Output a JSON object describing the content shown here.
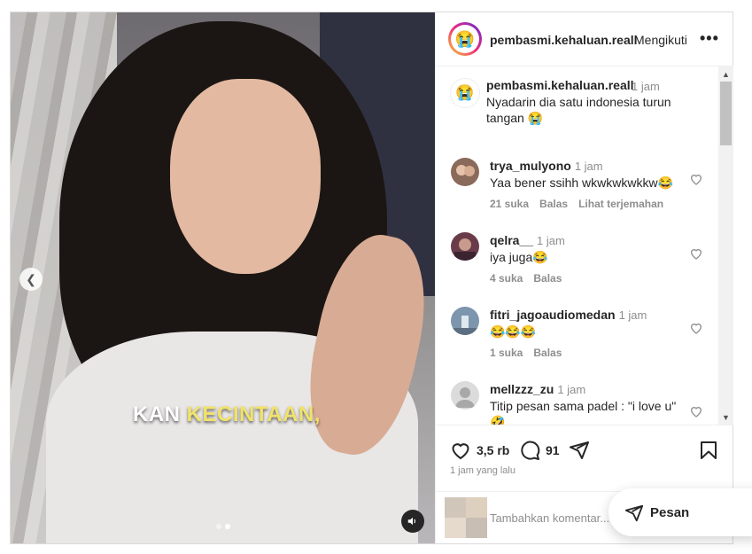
{
  "media": {
    "caption_white": "KAN ",
    "caption_yellow": "KECINTAAN,",
    "slide_current": 2,
    "slide_count": 2
  },
  "header": {
    "username": "pembasmi.kehaluan.reall",
    "follow_label": "Mengikuti",
    "more_label": "•••"
  },
  "caption": {
    "username": "pembasmi.kehaluan.reall",
    "time": "1 jam",
    "text": "Nyadarin dia satu indonesia turun tangan 😭"
  },
  "comments": [
    {
      "username": "trya_mulyono",
      "time": "1 jam",
      "text": "Yaa bener ssihh wkwkwkwkkw😂",
      "likes": "21 suka",
      "reply": "Balas",
      "translate": "Lihat terjemahan",
      "avatar_color": "#8a6a5a"
    },
    {
      "username": "qelra__",
      "time": "1 jam",
      "text": "iya juga😂",
      "likes": "4 suka",
      "reply": "Balas",
      "translate": "",
      "avatar_color": "#6a3c4a"
    },
    {
      "username": "fitri_jagoaudiomedan",
      "time": "1 jam",
      "text": "😂😂😂",
      "likes": "1 suka",
      "reply": "Balas",
      "translate": "",
      "avatar_color": "#7d95ad"
    },
    {
      "username": "mellzzz_zu",
      "time": "1 jam",
      "text": "Titip pesan sama padel : \"i love u\" 🤣",
      "likes": "",
      "reply": "",
      "translate": "",
      "avatar_color": "#c7c7c7"
    }
  ],
  "actions": {
    "likes": "3,5 rb",
    "comments": "91",
    "time_ago": "1 jam yang lalu"
  },
  "add_comment": {
    "placeholder": "Tambahkan komentar..."
  },
  "pesan": {
    "label": "Pesan"
  },
  "colors": {
    "text": "#262626",
    "muted": "#8e8e8e",
    "caption_yellow": "#f1e36a"
  }
}
